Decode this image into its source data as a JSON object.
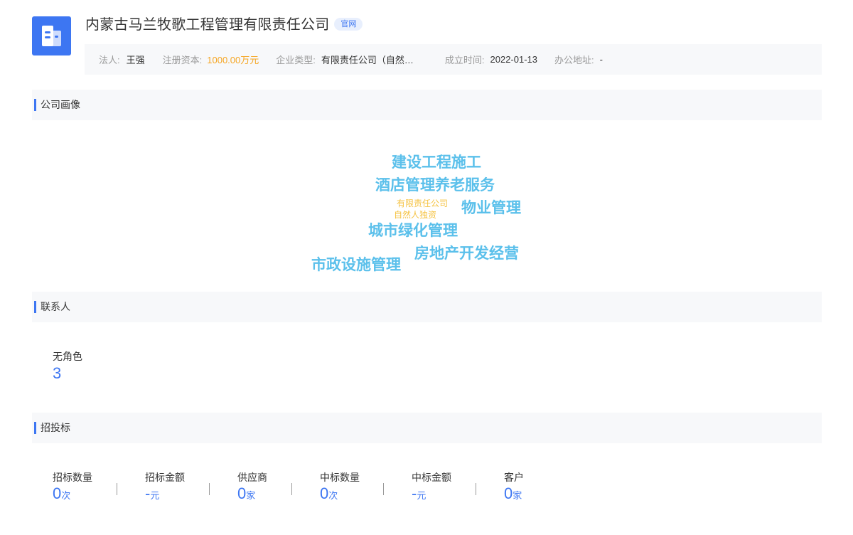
{
  "company": {
    "name": "内蒙古马兰牧歌工程管理有限责任公司",
    "official_tag": "官网"
  },
  "info": [
    {
      "label": "法人:",
      "value": "王强"
    },
    {
      "label": "注册资本:",
      "value": "1000.00万元"
    },
    {
      "label": "企业类型:",
      "value": "有限责任公司（自然人独资）"
    },
    {
      "label": "成立时间:",
      "value": "2022-01-13"
    },
    {
      "label": "办公地址:",
      "value": "-"
    }
  ],
  "sections": {
    "portrait": "公司画像",
    "contacts": "联系人",
    "bidding": "招投标"
  },
  "word_cloud": [
    "建设工程施工",
    "酒店管理养老服务",
    "有限责任公司",
    "自然人独资",
    "物业管理",
    "城市绿化管理",
    "房地产开发经营",
    "市政设施管理"
  ],
  "contact": {
    "role": "无角色",
    "count": "3"
  },
  "bidding": [
    {
      "label": "招标数量",
      "value": "0",
      "unit": "次"
    },
    {
      "label": "招标金额",
      "value": "-",
      "unit": "元"
    },
    {
      "label": "供应商",
      "value": "0",
      "unit": "家"
    },
    {
      "label": "中标数量",
      "value": "0",
      "unit": "次"
    },
    {
      "label": "中标金额",
      "value": "-",
      "unit": "元"
    },
    {
      "label": "客户",
      "value": "0",
      "unit": "家"
    }
  ],
  "colors": {
    "accent": "#3d76f2",
    "money": "#f5a623",
    "cloud_primary": "#5bc0eb",
    "cloud_secondary": "#f5c343"
  }
}
